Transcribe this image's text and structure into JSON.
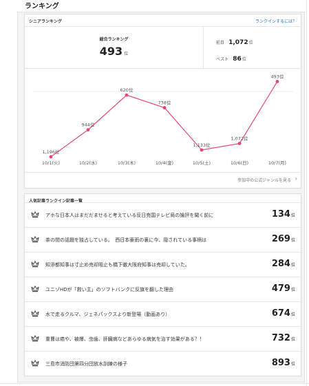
{
  "page": {
    "title": "ランキング"
  },
  "senior": {
    "header": "シニアランキング",
    "help_link": "ランクインするには？",
    "overall_label": "総合ランキング",
    "overall_rank": "493",
    "rank_unit": "位",
    "prev_label": "前日",
    "prev_rank": "1,072",
    "best_label": "ベスト",
    "best_rank": "86",
    "genre_link": "参加中の公式ジャンルを見る",
    "chevron": "›"
  },
  "chart_data": {
    "type": "line",
    "categories": [
      "10/1(火)",
      "10/2(水)",
      "10/3(木)",
      "10/4(金)",
      "10/5(土)",
      "10/6(日)",
      "10/7(月)"
    ],
    "values": [
      1196,
      944,
      620,
      738,
      1133,
      1072,
      493
    ],
    "point_labels": [
      "1,196位",
      "944位",
      "620位",
      "738位",
      "1,133位",
      "1,072位",
      "493位"
    ],
    "y_inverted": true,
    "series_color": "#e5457a"
  },
  "articles": {
    "header": "人気記事ランクイン記事一覧",
    "icon": "crown-icon",
    "unit": "位",
    "items": [
      {
        "title": "アホな日本人はまだだませると考えている反日売国テレビ局の論評を聞く前に",
        "rank": "134"
      },
      {
        "title": "茶の間の話題を独占している。　西日本豪雨の裏に今、隠されている事柄は",
        "rank": "269"
      },
      {
        "title": "知添都知事は寸止め売却阻止も橋下徹大阪府知事は売却していた。",
        "rank": "284"
      },
      {
        "title": "ユニゾHDが「救い主」のソフトバンクに反旗を翻した理由",
        "rank": "479"
      },
      {
        "title": "水で走るクルマ、ジェネパックスより新登場（動画あり）",
        "rank": "674"
      },
      {
        "title": "重曹は癌や、被爆、虫歯、肝臓病などあらゆる病気を治す効果がある？！",
        "rank": "732"
      },
      {
        "title": "三島市消防団第四分団放水訓練の様子",
        "rank": "893"
      }
    ]
  }
}
